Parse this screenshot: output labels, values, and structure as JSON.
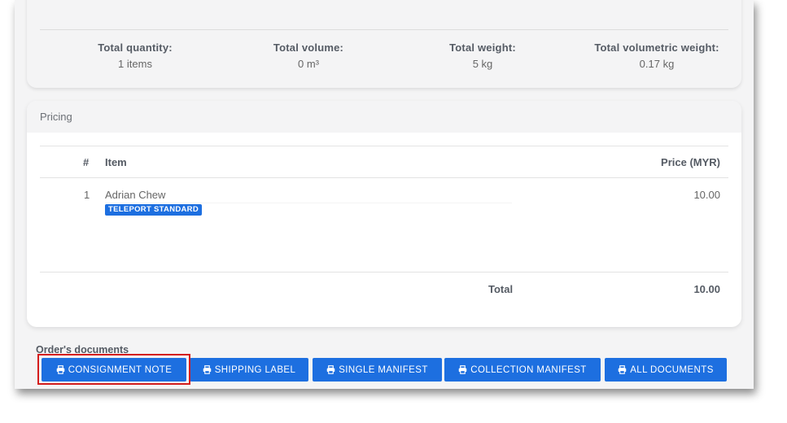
{
  "summary": {
    "stats": [
      {
        "label": "Total quantity:",
        "value": "1 items"
      },
      {
        "label": "Total volume:",
        "value": "0 m³"
      },
      {
        "label": "Total weight:",
        "value": "5 kg"
      },
      {
        "label": "Total volumetric weight:",
        "value": "0.17 kg"
      }
    ]
  },
  "pricing": {
    "title": "Pricing",
    "columns": {
      "number": "#",
      "item": "Item",
      "price": "Price (MYR)"
    },
    "rows": [
      {
        "number": "1",
        "item": "Adrian Chew",
        "badge": "TELEPORT STANDARD",
        "price": "10.00"
      }
    ],
    "total_label": "Total",
    "total_value": "10.00"
  },
  "documents": {
    "title": "Order's documents",
    "buttons": [
      {
        "label": "CONSIGNMENT NOTE",
        "icon": "printer-icon"
      },
      {
        "label": "SHIPPING LABEL",
        "icon": "printer-icon"
      },
      {
        "label": "SINGLE MANIFEST",
        "icon": "printer-icon"
      },
      {
        "label": "COLLECTION MANIFEST",
        "icon": "printer-icon"
      },
      {
        "label": "ALL DOCUMENTS",
        "icon": "printer-icon"
      }
    ]
  },
  "colors": {
    "button": "#1d6fe0",
    "highlight": "#d41c1c",
    "card_background": "#f4f4f5"
  }
}
